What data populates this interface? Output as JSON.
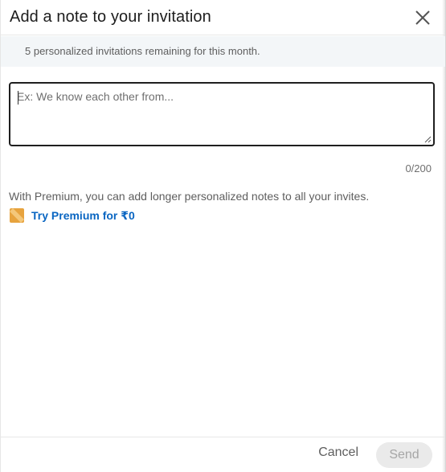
{
  "header": {
    "title": "Add a note to your invitation",
    "close_icon": "close-icon"
  },
  "banner": {
    "text": "5 personalized invitations remaining for this month."
  },
  "note": {
    "placeholder": "Ex: We know each other from...",
    "value": "",
    "counter": "0/200"
  },
  "premium": {
    "description": "With Premium, you can add longer personalized notes to all your invites.",
    "link_label": "Try Premium for ₹0",
    "icon": "premium-badge-icon",
    "link_color": "#0a66c2",
    "badge_color": "#e7a33e"
  },
  "footer": {
    "cancel_label": "Cancel",
    "send_label": "Send",
    "send_enabled": false
  }
}
